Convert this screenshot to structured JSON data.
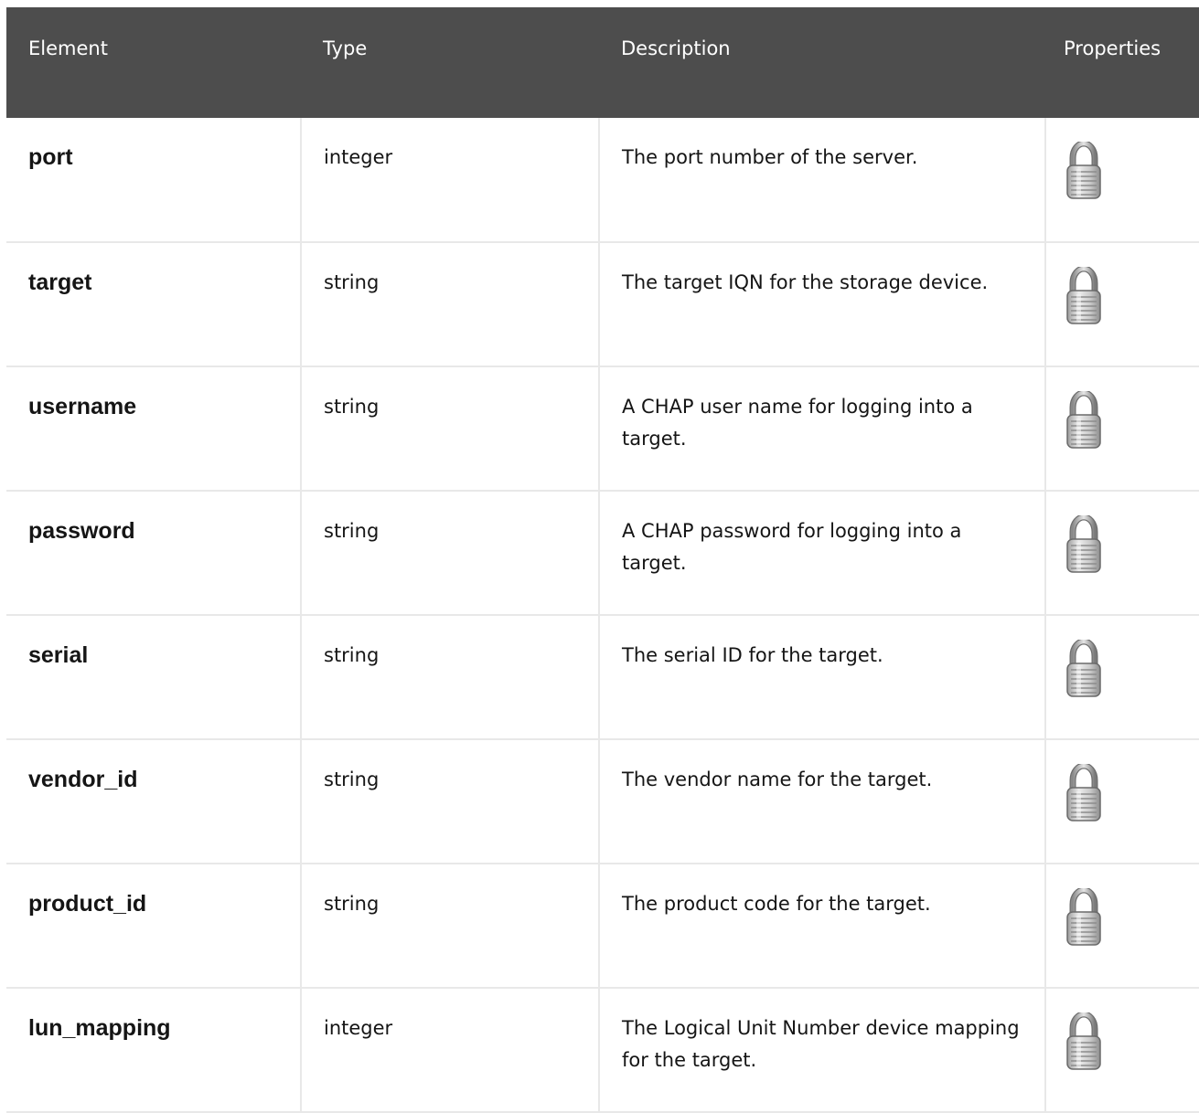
{
  "table": {
    "headers": [
      "Element",
      "Type",
      "Description",
      "Properties"
    ],
    "rows": [
      {
        "element": "port",
        "type": "integer",
        "description": "The port number of the server.",
        "property_icon": "lock-icon"
      },
      {
        "element": "target",
        "type": "string",
        "description": "The target IQN for the storage device.",
        "property_icon": "lock-icon"
      },
      {
        "element": "username",
        "type": "string",
        "description": "A CHAP user name for logging into a target.",
        "property_icon": "lock-icon"
      },
      {
        "element": "password",
        "type": "string",
        "description": "A CHAP password for logging into a target.",
        "property_icon": "lock-icon"
      },
      {
        "element": "serial",
        "type": "string",
        "description": "The serial ID for the target.",
        "property_icon": "lock-icon"
      },
      {
        "element": "vendor_id",
        "type": "string",
        "description": "The vendor name for the target.",
        "property_icon": "lock-icon"
      },
      {
        "element": "product_id",
        "type": "string",
        "description": "The product code for the target.",
        "property_icon": "lock-icon"
      },
      {
        "element": "lun_mapping",
        "type": "integer",
        "description": "The Logical Unit Number device mapping for the target.",
        "property_icon": "lock-icon"
      }
    ]
  },
  "colors": {
    "header_background": "#4d4d4d",
    "header_text": "#ffffff",
    "grid_line": "#e8e8e8",
    "body_text": "#151515"
  }
}
